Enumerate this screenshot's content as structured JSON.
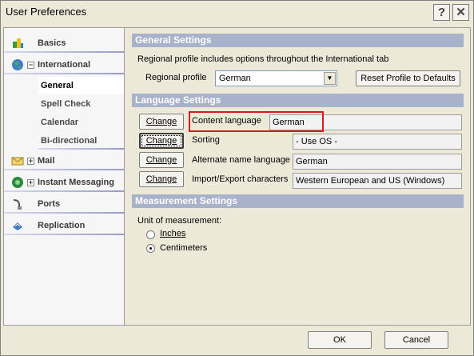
{
  "window": {
    "title": "User Preferences",
    "help_symbol": "?",
    "close_symbol": "✕"
  },
  "sidebar": {
    "items": [
      {
        "label": "Basics",
        "icon": "basics-icon",
        "expander": ""
      },
      {
        "label": "International",
        "icon": "globe-icon",
        "expander": "−"
      },
      {
        "label": "Mail",
        "icon": "mail-icon",
        "expander": "+"
      },
      {
        "label": "Instant Messaging",
        "icon": "instant-messaging-icon",
        "expander": "+"
      },
      {
        "label": "Ports",
        "icon": "ports-icon",
        "expander": ""
      },
      {
        "label": "Replication",
        "icon": "replication-icon",
        "expander": ""
      }
    ],
    "subitems": [
      "General",
      "Spell Check",
      "Calendar",
      "Bi-directional"
    ]
  },
  "general": {
    "header": "General Settings",
    "description": "Regional profile includes options throughout the International tab",
    "profile_label": "Regional profile",
    "profile_value": "German",
    "reset_button": "Reset Profile to Defaults"
  },
  "language": {
    "header": "Language Settings",
    "change_label": "Change",
    "rows": [
      {
        "label": "Content language",
        "value": "German"
      },
      {
        "label": "Sorting",
        "value": "- Use OS -"
      },
      {
        "label": "Alternate name language",
        "value": "German"
      },
      {
        "label": "Import/Export characters",
        "value": "Western European and US (Windows)"
      }
    ]
  },
  "measurement": {
    "header": "Measurement Settings",
    "unit_label": "Unit of measurement:",
    "options": [
      "Inches",
      "Centimeters"
    ],
    "selected": "Centimeters"
  },
  "footer": {
    "ok": "OK",
    "cancel": "Cancel"
  },
  "colors": {
    "section_header": "#a9b2cb",
    "highlight_border": "#d91a1a",
    "background": "#ece9d8"
  }
}
